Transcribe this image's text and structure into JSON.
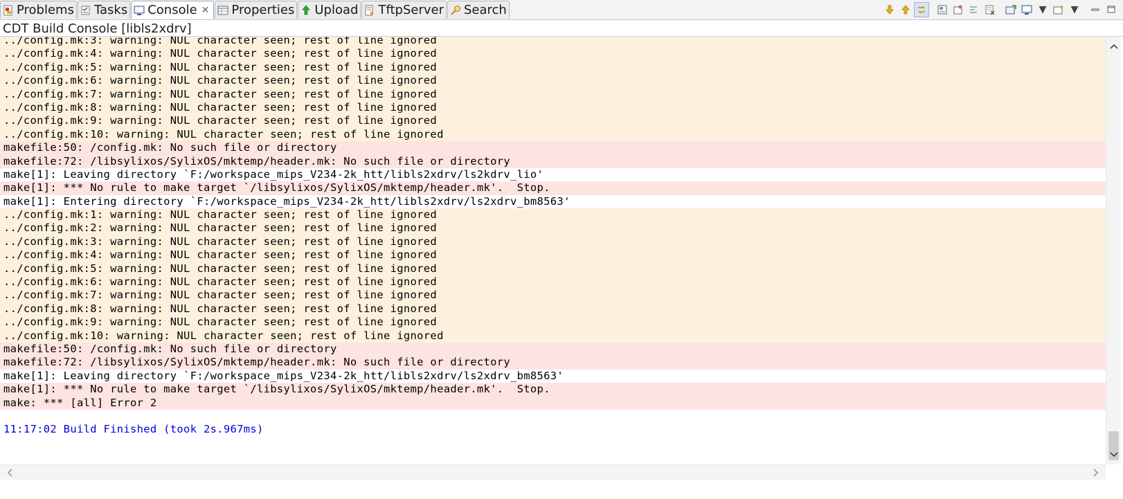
{
  "tabs": [
    {
      "label": "Problems",
      "icon": "problems-icon"
    },
    {
      "label": "Tasks",
      "icon": "tasks-icon"
    },
    {
      "label": "Console",
      "icon": "console-icon",
      "active": true
    },
    {
      "label": "Properties",
      "icon": "properties-icon"
    },
    {
      "label": "Upload",
      "icon": "upload-icon"
    },
    {
      "label": "TftpServer",
      "icon": "tftp-server-icon"
    },
    {
      "label": "Search",
      "icon": "search-icon"
    }
  ],
  "console_title": "CDT Build Console [libls2xdrv]",
  "toolbar_icons": [
    "next-error-icon",
    "previous-error-icon",
    "link-with-editor-icon",
    "scroll-lock-icon",
    "pin-console-icon",
    "word-wrap-icon",
    "clear-console-icon",
    "open-console-icon",
    "display-console-icon",
    "dropdown-icon",
    "new-console-icon",
    "dropdown-icon",
    "minimize-icon",
    "maximize-icon"
  ],
  "lines": [
    {
      "text": "../config.mk:3: warning: NUL character seen; rest of line ignored",
      "kind": "warn"
    },
    {
      "text": "../config.mk:4: warning: NUL character seen; rest of line ignored",
      "kind": "warn"
    },
    {
      "text": "../config.mk:5: warning: NUL character seen; rest of line ignored",
      "kind": "warn"
    },
    {
      "text": "../config.mk:6: warning: NUL character seen; rest of line ignored",
      "kind": "warn"
    },
    {
      "text": "../config.mk:7: warning: NUL character seen; rest of line ignored",
      "kind": "warn"
    },
    {
      "text": "../config.mk:8: warning: NUL character seen; rest of line ignored",
      "kind": "warn"
    },
    {
      "text": "../config.mk:9: warning: NUL character seen; rest of line ignored",
      "kind": "warn"
    },
    {
      "text": "../config.mk:10: warning: NUL character seen; rest of line ignored",
      "kind": "warn"
    },
    {
      "text": "makefile:50: /config.mk: No such file or directory",
      "kind": "err"
    },
    {
      "text": "makefile:72: /libsylixos/SylixOS/mktemp/header.mk: No such file or directory",
      "kind": "err"
    },
    {
      "text": "make[1]: Leaving directory `F:/workspace_mips_V234-2k_htt/libls2xdrv/ls2kdrv_lio'",
      "kind": "info"
    },
    {
      "text": "make[1]: *** No rule to make target `/libsylixos/SylixOS/mktemp/header.mk'.  Stop.",
      "kind": "err"
    },
    {
      "text": "make[1]: Entering directory `F:/workspace_mips_V234-2k_htt/libls2xdrv/ls2xdrv_bm8563'",
      "kind": "info"
    },
    {
      "text": "../config.mk:1: warning: NUL character seen; rest of line ignored",
      "kind": "warn"
    },
    {
      "text": "../config.mk:2: warning: NUL character seen; rest of line ignored",
      "kind": "warn"
    },
    {
      "text": "../config.mk:3: warning: NUL character seen; rest of line ignored",
      "kind": "warn"
    },
    {
      "text": "../config.mk:4: warning: NUL character seen; rest of line ignored",
      "kind": "warn"
    },
    {
      "text": "../config.mk:5: warning: NUL character seen; rest of line ignored",
      "kind": "warn"
    },
    {
      "text": "../config.mk:6: warning: NUL character seen; rest of line ignored",
      "kind": "warn"
    },
    {
      "text": "../config.mk:7: warning: NUL character seen; rest of line ignored",
      "kind": "warn"
    },
    {
      "text": "../config.mk:8: warning: NUL character seen; rest of line ignored",
      "kind": "warn"
    },
    {
      "text": "../config.mk:9: warning: NUL character seen; rest of line ignored",
      "kind": "warn"
    },
    {
      "text": "../config.mk:10: warning: NUL character seen; rest of line ignored",
      "kind": "warn"
    },
    {
      "text": "makefile:50: /config.mk: No such file or directory",
      "kind": "err"
    },
    {
      "text": "makefile:72: /libsylixos/SylixOS/mktemp/header.mk: No such file or directory",
      "kind": "err"
    },
    {
      "text": "make[1]: Leaving directory `F:/workspace_mips_V234-2k_htt/libls2xdrv/ls2xdrv_bm8563'",
      "kind": "info"
    },
    {
      "text": "make[1]: *** No rule to make target `/libsylixos/SylixOS/mktemp/header.mk'.  Stop.",
      "kind": "err"
    },
    {
      "text": "make: *** [all] Error 2",
      "kind": "err"
    },
    {
      "text": "",
      "kind": "blank"
    },
    {
      "text": "11:17:02 Build Finished (took 2s.967ms)",
      "kind": "done"
    }
  ],
  "colors": {
    "warning_bg": "#fdf1dd",
    "error_bg": "#fde4e0",
    "build_finished": "#0000d8"
  }
}
